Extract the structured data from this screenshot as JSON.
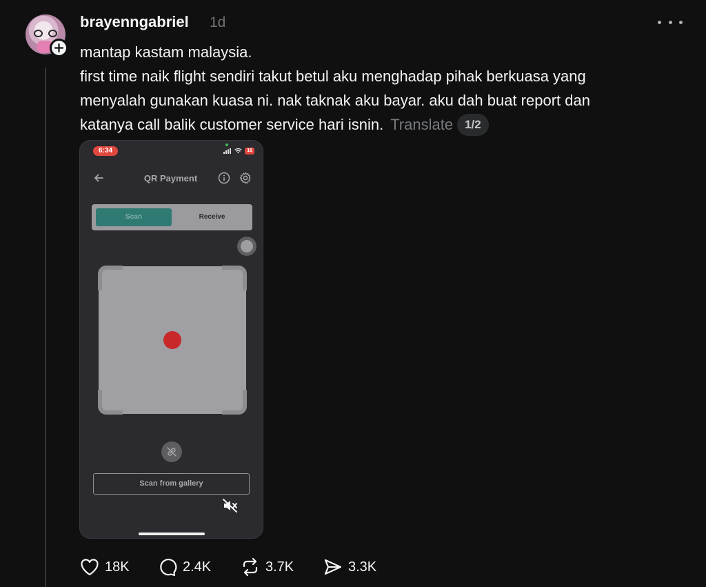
{
  "post": {
    "username": "brayenngabriel",
    "time": "1d",
    "lines": [
      "mantap kastam malaysia.",
      "first time naik flight sendiri takut betul aku menghadap pihak berkuasa yang",
      "menyalah gunakan kuasa ni. nak taknak aku bayar. aku dah buat report dan",
      "katanya call balik customer service hari isnin."
    ],
    "translate_label": "Translate",
    "media_counter": "1/2"
  },
  "media": {
    "status_time": "6:34",
    "battery": "16",
    "title": "QR Payment",
    "tab_scan": "Scan",
    "tab_receive": "Receive",
    "gallery_button": "Scan from gallery"
  },
  "actions": {
    "likes": "18K",
    "comments": "2.4K",
    "reposts": "3.7K",
    "shares": "3.3K"
  },
  "colors": {
    "background": "#101010",
    "text": "#f3f5f7",
    "muted": "#777a7e",
    "scan_tab": "#2f7a73",
    "record_dot": "#c8282a"
  }
}
